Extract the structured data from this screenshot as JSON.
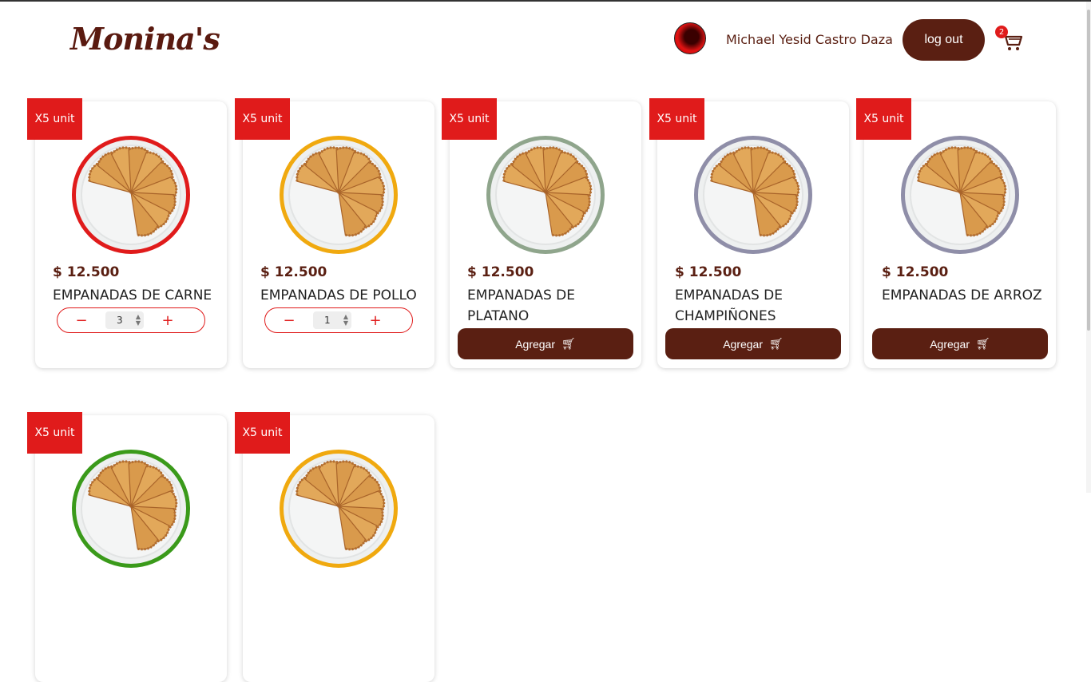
{
  "header": {
    "logo_text": "Monina's",
    "user_name": "Michael Yesid Castro Daza",
    "logout_label": "log out",
    "cart_count": "2"
  },
  "products": [
    {
      "badge": "X5 unit",
      "price": "$ 12.500",
      "name": "EMPANADAS DE CARNE",
      "ring_color": "#e01b1b",
      "mode": "qty",
      "qty": "3"
    },
    {
      "badge": "X5 unit",
      "price": "$ 12.500",
      "name": "EMPANADAS DE POLLO",
      "ring_color": "#f0a90f",
      "mode": "qty",
      "qty": "1"
    },
    {
      "badge": "X5 unit",
      "price": "$ 12.500",
      "name": "EMPANADAS DE PLATANO",
      "ring_color": "#8fa58c",
      "mode": "add",
      "add_label": "Agregar"
    },
    {
      "badge": "X5 unit",
      "price": "$ 12.500",
      "name": "EMPANADAS DE CHAMPIÑONES",
      "ring_color": "#8f8ea8",
      "mode": "add",
      "add_label": "Agregar"
    },
    {
      "badge": "X5 unit",
      "price": "$ 12.500",
      "name": "EMPANADAS DE ARROZ",
      "ring_color": "#8f8ea8",
      "mode": "add",
      "add_label": "Agregar"
    },
    {
      "badge": "X5 unit",
      "ring_color": "#3a9a1a"
    },
    {
      "badge": "X5 unit",
      "ring_color": "#f0a90f"
    }
  ],
  "colors": {
    "brand": "#5a1f12",
    "accent": "#e01b1b"
  }
}
